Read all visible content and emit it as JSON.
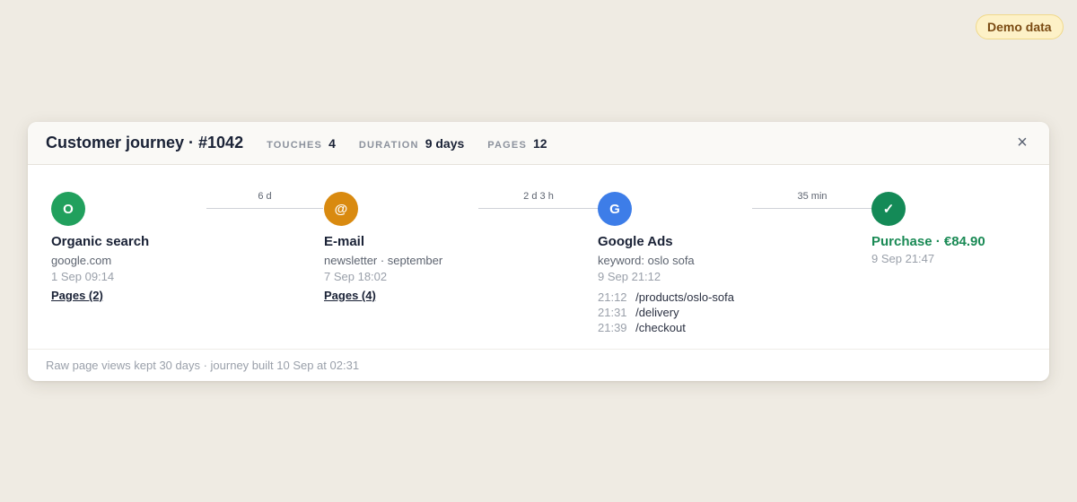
{
  "badge": "Demo data",
  "header": {
    "title": "Customer journey · #1042",
    "stats": [
      {
        "label": "TOUCHES",
        "value": "4"
      },
      {
        "label": "DURATION",
        "value": "9 days"
      },
      {
        "label": "PAGES",
        "value": "12"
      }
    ],
    "close_icon": "×"
  },
  "steps": [
    {
      "icon": "O",
      "color": "#21a05d",
      "name": "Organic search",
      "detail": "google.com",
      "time": "1 Sep 09:14",
      "link": "Pages (2)"
    },
    {
      "icon": "@",
      "color": "#d98a10",
      "name": "E-mail",
      "detail": "newsletter · september",
      "time": "7 Sep 18:02",
      "link": "Pages (4)"
    },
    {
      "icon": "G",
      "color": "#3d7de8",
      "name": "Google Ads",
      "detail": "keyword: oslo sofa",
      "time": "9 Sep 21:12",
      "page_views": [
        {
          "time": "21:12",
          "path": "/products/oslo-sofa"
        },
        {
          "time": "21:31",
          "path": "/delivery"
        },
        {
          "time": "21:39",
          "path": "/checkout"
        }
      ]
    },
    {
      "icon": "✓",
      "color": "#148a57",
      "name": "Purchase · €84.90",
      "time": "9 Sep 21:47"
    }
  ],
  "gaps": [
    "6 d",
    "2 d 3 h",
    "35 min"
  ],
  "footer": "Raw page views kept 30 days · journey built 10 Sep at 02:31"
}
